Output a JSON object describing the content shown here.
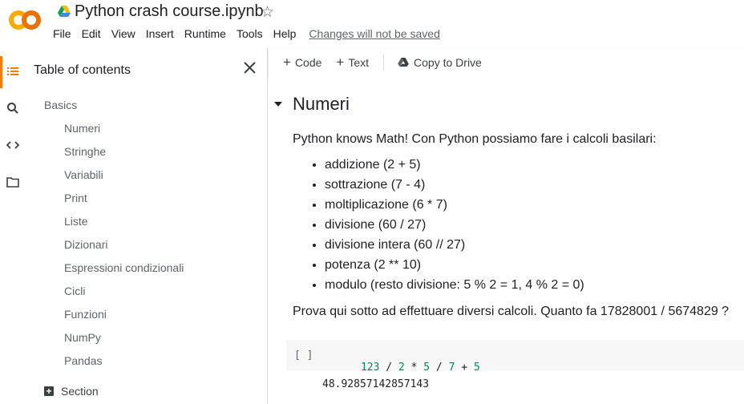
{
  "app": {
    "logo_text": "CO",
    "title": "Python crash course.ipynb",
    "menu": [
      "File",
      "Edit",
      "View",
      "Insert",
      "Runtime",
      "Tools",
      "Help"
    ],
    "unsaved_text": "Changes will not be saved",
    "accent_color": "#f9ab00",
    "accent_color_2": "#e8710a"
  },
  "rail": {
    "icons": [
      "toc-icon",
      "search-icon",
      "code-icon",
      "folder-icon"
    ]
  },
  "toc": {
    "title": "Table of contents",
    "top_item": "Basics",
    "items": [
      "Numeri",
      "Stringhe",
      "Variabili",
      "Print",
      "Liste",
      "Dizionari",
      "Espressioni condizionali",
      "Cicli",
      "Funzioni",
      "NumPy",
      "Pandas"
    ],
    "add_section": "Section"
  },
  "toolbar": {
    "code_label": "Code",
    "text_label": "Text",
    "copy_label": "Copy to Drive"
  },
  "content": {
    "heading": "Numeri",
    "intro": "Python knows Math! Con Python possiamo fare i calcoli basilari:",
    "bullets": [
      "addizione (2 + 5)",
      "sottrazione (7 - 4)",
      "moltiplicazione (6 * 7)",
      "divisione (60 / 27)",
      "divisione intera (60 // 27)",
      "potenza (2 ** 10)",
      "modulo (resto divisione: 5 % 2 = 1, 4 % 2 = 0)"
    ],
    "prompt": "Prova qui sotto ad effettuare diversi calcoli. Quanto fa 17828001 / 5674829 ?"
  },
  "cell": {
    "bracket": "[ ]",
    "tokens": [
      {
        "t": "123",
        "k": "num"
      },
      {
        "t": " / ",
        "k": "op"
      },
      {
        "t": "2",
        "k": "num"
      },
      {
        "t": " * ",
        "k": "op"
      },
      {
        "t": "5",
        "k": "num"
      },
      {
        "t": " / ",
        "k": "op"
      },
      {
        "t": "7",
        "k": "num"
      },
      {
        "t": " + ",
        "k": "op"
      },
      {
        "t": "5",
        "k": "num"
      }
    ],
    "output": "48.92857142857143"
  }
}
